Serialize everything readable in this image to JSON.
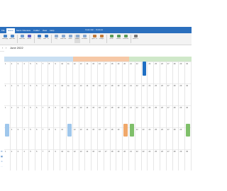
{
  "tabs": [
    {
      "label": "File"
    },
    {
      "label": "Home",
      "active": true
    },
    {
      "label": "Send / Receive"
    },
    {
      "label": "Folder"
    },
    {
      "label": "View"
    },
    {
      "label": "Help"
    }
  ],
  "window_title": "Calendar - Outlook",
  "ribbon_buttons": [
    {
      "label": "New Appt",
      "icon": "new-appointment-icon",
      "color": "#4a86c8"
    },
    {
      "label": "New Meeting",
      "icon": "new-meeting-icon",
      "color": "#4a86c8"
    },
    {
      "label": "New Items",
      "icon": "new-items-icon",
      "color": "#6e9bd1"
    },
    {
      "label": "Teams",
      "icon": "teams-icon",
      "color": "#5b5fc7"
    },
    {
      "label": "Today",
      "icon": "today-icon",
      "color": "#3a78c2"
    },
    {
      "label": "Next 7 Days",
      "icon": "next-days-icon",
      "color": "#3a78c2"
    },
    {
      "label": "Day",
      "icon": "day-view-icon",
      "color": "#8aa9cf"
    },
    {
      "label": "Work Week",
      "icon": "work-week-icon",
      "color": "#8aa9cf"
    },
    {
      "label": "Week",
      "icon": "week-view-icon",
      "color": "#8aa9cf"
    },
    {
      "label": "Month",
      "icon": "month-view-icon",
      "color": "#8aa9cf",
      "selected": true
    },
    {
      "label": "Schedule",
      "icon": "schedule-view-icon",
      "color": "#8aa9cf"
    },
    {
      "label": "Open Cal",
      "icon": "open-calendar-icon",
      "color": "#c07a3a"
    },
    {
      "label": "Groups",
      "icon": "calendar-groups-icon",
      "color": "#c07a3a"
    },
    {
      "label": "Share",
      "icon": "share-calendar-icon",
      "color": "#5a9a5a"
    },
    {
      "label": "Publish",
      "icon": "publish-icon",
      "color": "#5a9a5a"
    },
    {
      "label": "Permissions",
      "icon": "permissions-icon",
      "color": "#5a9a5a"
    },
    {
      "label": "Search People",
      "icon": "search-people-icon",
      "color": "#777777"
    }
  ],
  "nav": {
    "prev": "‹",
    "next": "›",
    "month": "June 2022"
  },
  "rail_icons": [
    {
      "glyph": "✉",
      "name": "mail-icon"
    },
    {
      "glyph": "▦",
      "name": "calendar-icon"
    },
    {
      "glyph": "☺",
      "name": "people-icon"
    },
    {
      "glyph": "…",
      "name": "more-apps-icon"
    }
  ],
  "band_colors": {
    "blue": "#c9dff2",
    "orange": "#f6c8a6",
    "green": "#cfe8c9",
    "none": "#ffffff"
  },
  "days": [
    {
      "num": "1",
      "band": "blue"
    },
    {
      "num": "2",
      "band": "blue"
    },
    {
      "num": "3",
      "band": "blue"
    },
    {
      "num": "4",
      "band": "blue"
    },
    {
      "num": "5",
      "band": "blue"
    },
    {
      "num": "6",
      "band": "blue"
    },
    {
      "num": "7",
      "band": "blue"
    },
    {
      "num": "8",
      "band": "blue"
    },
    {
      "num": "9",
      "band": "blue"
    },
    {
      "num": "10",
      "band": "blue"
    },
    {
      "num": "11",
      "band": "blue"
    },
    {
      "num": "12",
      "band": "orange"
    },
    {
      "num": "13",
      "band": "orange"
    },
    {
      "num": "14",
      "band": "orange"
    },
    {
      "num": "15",
      "band": "orange"
    },
    {
      "num": "16",
      "band": "orange"
    },
    {
      "num": "17",
      "band": "orange"
    },
    {
      "num": "18",
      "band": "orange"
    },
    {
      "num": "19",
      "band": "orange"
    },
    {
      "num": "20",
      "band": "orange"
    },
    {
      "num": "21",
      "band": "green"
    },
    {
      "num": "22",
      "band": "green"
    },
    {
      "num": "23",
      "band": "green"
    },
    {
      "num": "24",
      "band": "green"
    },
    {
      "num": "25",
      "band": "green"
    },
    {
      "num": "26",
      "band": "green"
    },
    {
      "num": "27",
      "band": "green"
    },
    {
      "num": "28",
      "band": "green"
    },
    {
      "num": "29",
      "band": "green"
    },
    {
      "num": "30",
      "band": "green"
    }
  ],
  "events": [
    {
      "day": 0,
      "color": "#9fc7ec",
      "kind": "light-blue-event"
    },
    {
      "day": 10,
      "color": "#9fc7ec",
      "kind": "light-blue-event"
    },
    {
      "day": 19,
      "color": "#f0a86a",
      "kind": "orange-event"
    },
    {
      "day": 20,
      "color": "#7fbf6a",
      "kind": "green-event"
    },
    {
      "day": 22,
      "color": "#1f6fc3",
      "kind": "dark-blue-event"
    },
    {
      "day": 29,
      "color": "#7fbf6a",
      "kind": "green-event"
    }
  ]
}
